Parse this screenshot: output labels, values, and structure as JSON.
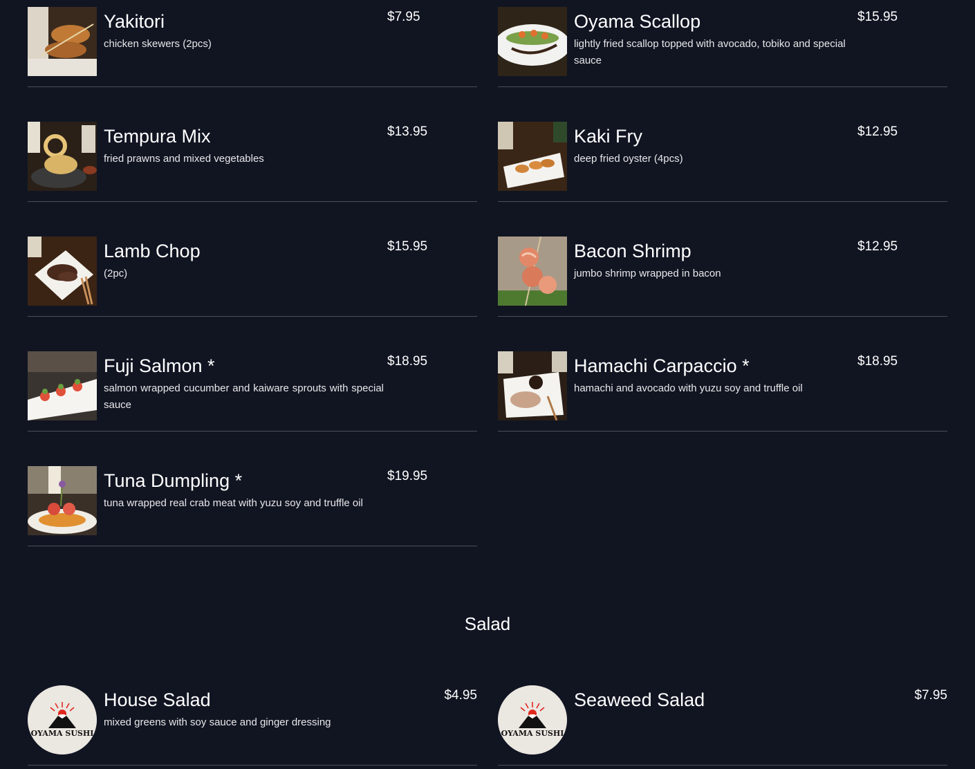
{
  "appetizers": [
    {
      "name": "Yakitori",
      "desc": "chicken skewers (2pcs)",
      "price": "$7.95",
      "image": "yakitori-photo"
    },
    {
      "name": "Oyama Scallop",
      "desc": "lightly fried scallop topped with avocado, tobiko and special sauce",
      "price": "$15.95",
      "image": "scallop-photo"
    },
    {
      "name": "Tempura Mix",
      "desc": "fried prawns and mixed vegetables",
      "price": "$13.95",
      "image": "tempura-photo"
    },
    {
      "name": "Kaki Fry",
      "desc": "deep fried oyster (4pcs)",
      "price": "$12.95",
      "image": "kaki-fry-photo"
    },
    {
      "name": "Lamb Chop",
      "desc": "(2pc)",
      "price": "$15.95",
      "image": "lamb-chop-photo"
    },
    {
      "name": "Bacon Shrimp",
      "desc": "jumbo shrimp wrapped in bacon",
      "price": "$12.95",
      "image": "bacon-shrimp-photo"
    },
    {
      "name": "Fuji Salmon *",
      "desc": "salmon wrapped cucumber and kaiware sprouts with special sauce",
      "price": "$18.95",
      "image": "fuji-salmon-photo"
    },
    {
      "name": "Hamachi Carpaccio *",
      "desc": "hamachi and avocado with yuzu soy and truffle oil",
      "price": "$18.95",
      "image": "hamachi-photo"
    },
    {
      "name": "Tuna Dumpling *",
      "desc": "tuna wrapped real crab meat with yuzu soy and truffle oil",
      "price": "$19.95",
      "image": "tuna-dumpling-photo"
    }
  ],
  "salad_section": {
    "title": "Salad",
    "items": [
      {
        "name": "House Salad",
        "desc": "mixed greens with soy sauce and ginger dressing",
        "price": "$4.95"
      },
      {
        "name": "Seaweed Salad",
        "desc": "",
        "price": "$7.95"
      }
    ]
  },
  "logo": {
    "text": "OYAMA SUSHI"
  },
  "colors": {
    "background": "#111522",
    "divider": "#4a4f5c",
    "text": "#ffffff",
    "logo_sun": "#e0281e"
  }
}
